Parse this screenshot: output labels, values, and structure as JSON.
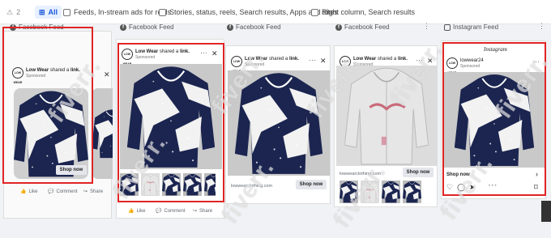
{
  "filters": {
    "warning_count": "2",
    "all_label": "All",
    "option_feeds": "Feeds, In-stream ads for reels",
    "option_stories": "Stories, status, reels, Search results, Apps and sites",
    "option_right": "Right column, Search results"
  },
  "placements": [
    {
      "label": "Facebook Feed"
    },
    {
      "label": "Facebook Feed"
    },
    {
      "label": "Facebook Feed"
    },
    {
      "label": "Facebook Feed"
    },
    {
      "label": "Instagram Feed"
    }
  ],
  "ad": {
    "brand": "Low Wear",
    "shared": "shared a",
    "link_word": "link.",
    "sponsored": "Sponsored",
    "logo_text": "LOW WEAR",
    "cta": "Shop now",
    "url": "lowwearclothing.com",
    "like": "Like",
    "comment": "Comment",
    "share": "Share"
  },
  "instagram": {
    "header": "Instagram",
    "handle": "lowwear24",
    "sponsored": "Sponsored",
    "cta": "Shop now"
  },
  "watermark": "fiverr.",
  "colors": {
    "highlight": "#e02424",
    "accent": "#1a56db",
    "hoodie_navy": "#1b2550"
  }
}
